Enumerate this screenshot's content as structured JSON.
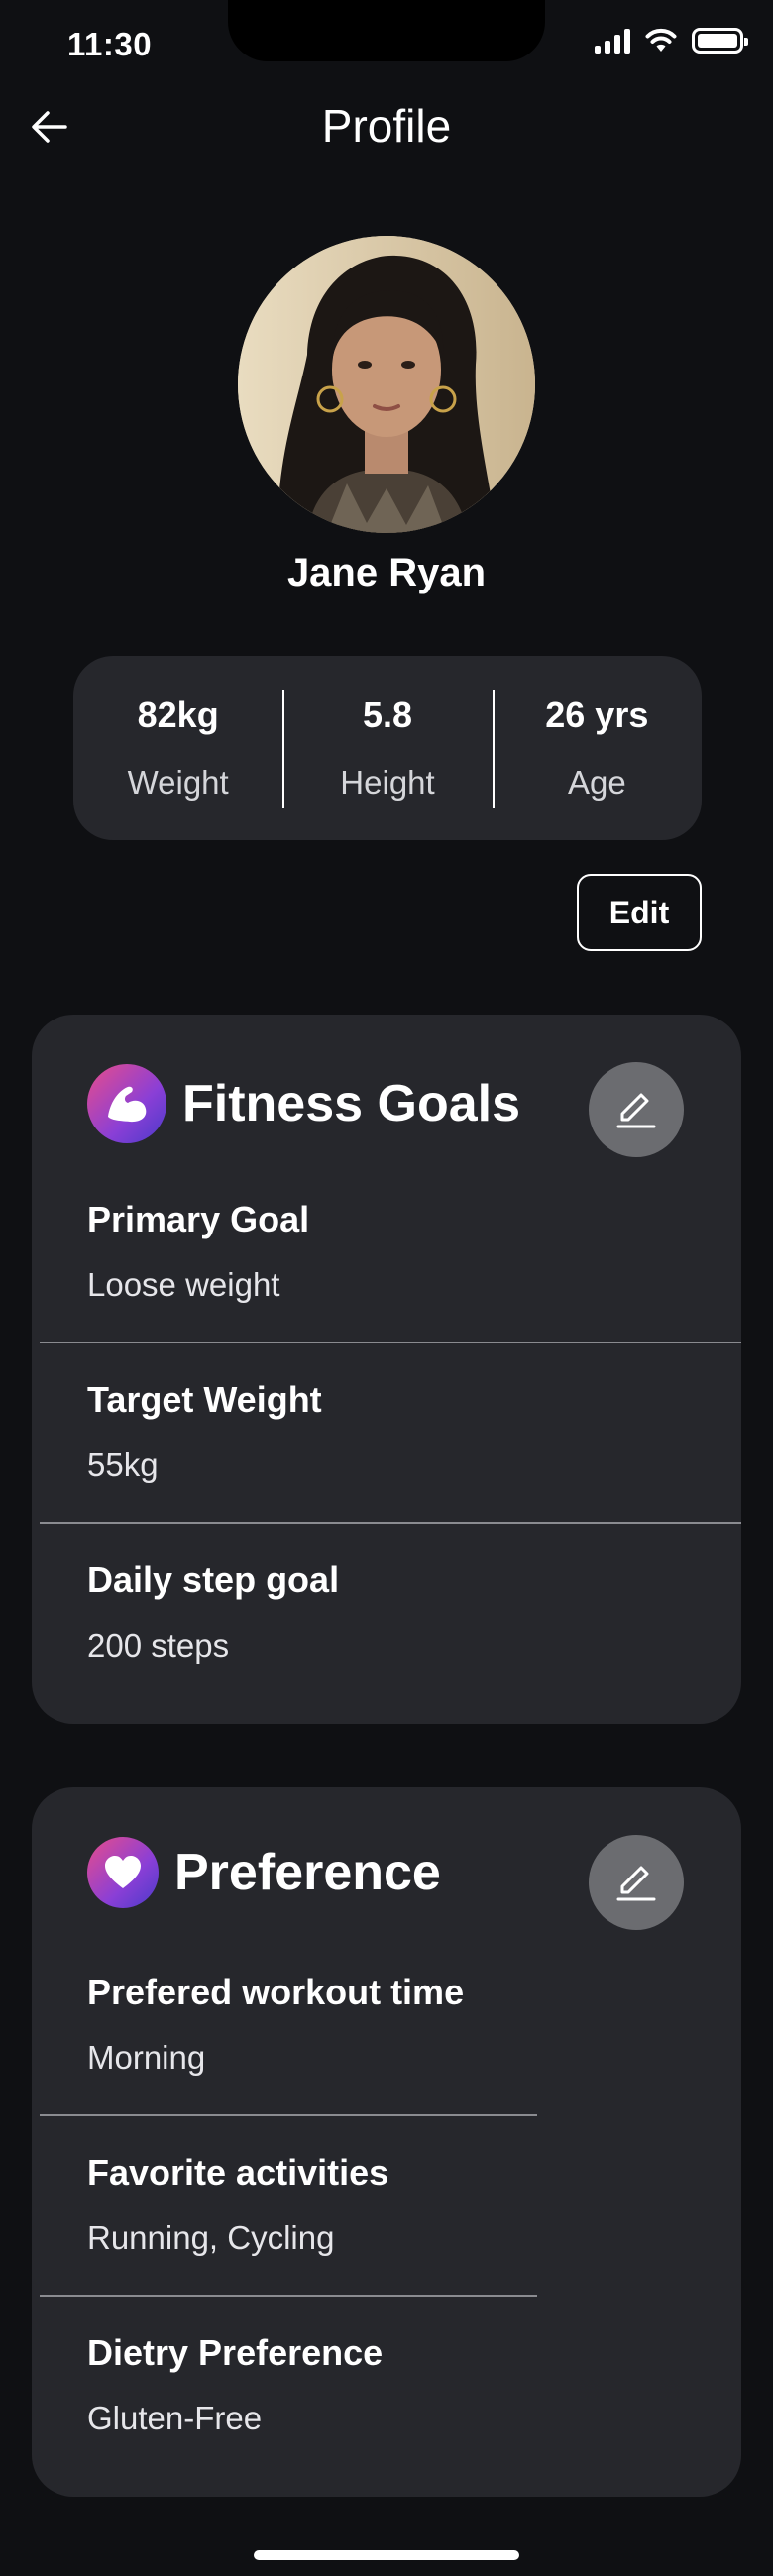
{
  "status_bar": {
    "time": "11:30"
  },
  "header": {
    "title": "Profile"
  },
  "profile": {
    "name": "Jane Ryan"
  },
  "stats": [
    {
      "value": "82kg",
      "label": "Weight"
    },
    {
      "value": "5.8",
      "label": "Height"
    },
    {
      "value": "26 yrs",
      "label": "Age"
    }
  ],
  "edit_label": "Edit",
  "fitness_goals": {
    "title": "Fitness Goals",
    "fields": [
      {
        "label": "Primary Goal",
        "value": "Loose weight"
      },
      {
        "label": "Target Weight",
        "value": "55kg"
      },
      {
        "label": "Daily step goal",
        "value": "200 steps"
      }
    ]
  },
  "preference": {
    "title": "Preference",
    "fields": [
      {
        "label": "Prefered workout time",
        "value": "Morning"
      },
      {
        "label": "Favorite activities",
        "value": "Running, Cycling"
      },
      {
        "label": "Dietry Preference",
        "value": "Gluten-Free"
      }
    ]
  },
  "colors": {
    "background": "#0f1013",
    "card": "#26272c",
    "badge_gradient": [
      "#e84d8a",
      "#8a3fd6",
      "#4a3ac9"
    ],
    "pencil_button": "#6b6c70"
  },
  "icons": [
    "back-arrow-icon",
    "cellular-signal-icon",
    "wifi-icon",
    "battery-icon",
    "flexed-bicep-icon",
    "heart-icon",
    "pencil-icon"
  ]
}
